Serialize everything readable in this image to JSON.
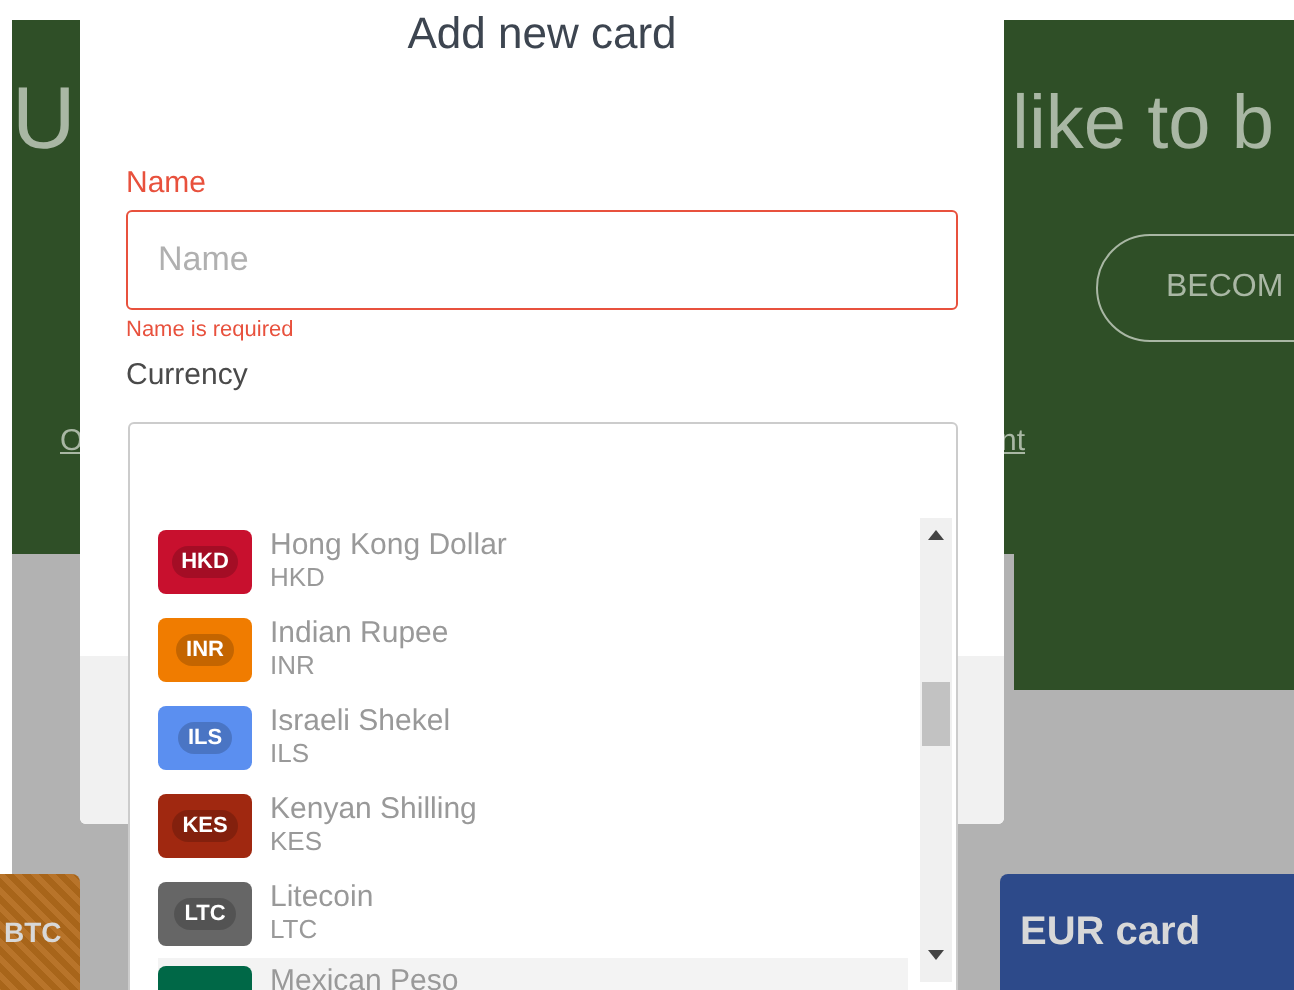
{
  "background": {
    "headline_left": "U",
    "headline_right": "like to b",
    "become_button": "BECOM",
    "link_left": "O",
    "link_right": "nt",
    "card_left": "BTC",
    "card_right": "EUR card"
  },
  "modal": {
    "title": "Add new card",
    "name_field": {
      "label": "Name",
      "placeholder": "Name",
      "error": "Name is required",
      "invalid": true
    },
    "currency_field": {
      "label": "Currency",
      "open": true,
      "options": [
        {
          "name": "Hong Kong Dollar",
          "code": "HKD",
          "badge": "HKD",
          "color": "#c8102e",
          "selected": false
        },
        {
          "name": "Indian Rupee",
          "code": "INR",
          "badge": "INR",
          "color": "#f07c00",
          "selected": false
        },
        {
          "name": "Israeli Shekel",
          "code": "ILS",
          "badge": "ILS",
          "color": "#5b8ff0",
          "selected": false
        },
        {
          "name": "Kenyan Shilling",
          "code": "KES",
          "badge": "KES",
          "color": "#a02810",
          "selected": false
        },
        {
          "name": "Litecoin",
          "code": "LTC",
          "badge": "LTC",
          "color": "#666666",
          "selected": false
        },
        {
          "name": "Mexican Peso",
          "color": "#006847",
          "selected": true
        }
      ]
    }
  }
}
